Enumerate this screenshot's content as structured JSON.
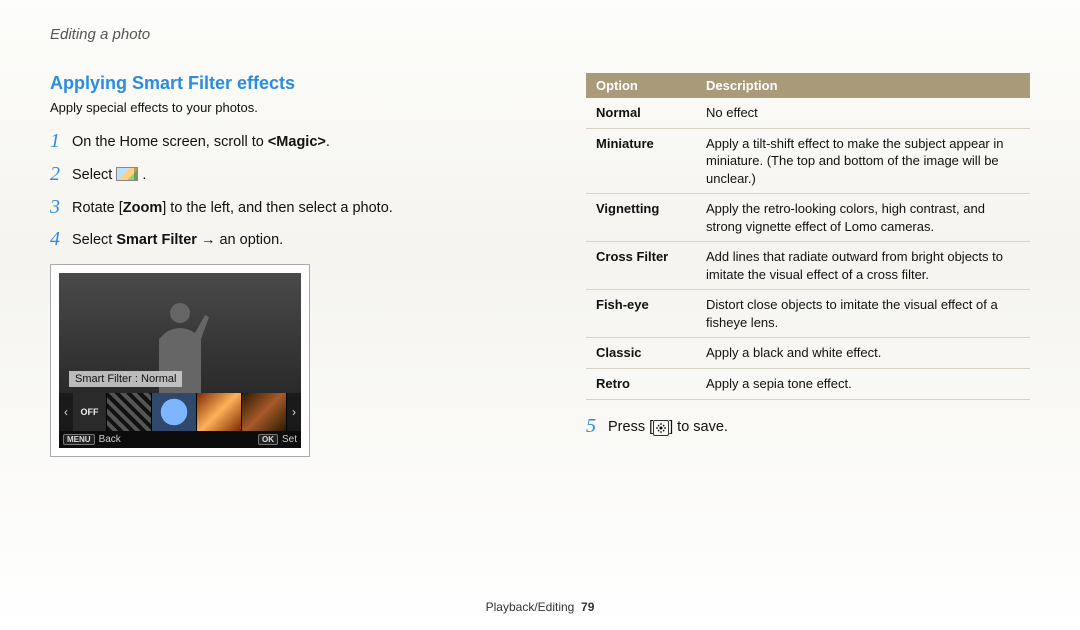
{
  "header": {
    "breadcrumb": "Editing a photo"
  },
  "section": {
    "title": "Applying Smart Filter effects",
    "intro": "Apply special effects to your photos."
  },
  "steps_left": [
    {
      "prefix": "On the Home screen, scroll to ",
      "bold": "<Magic>",
      "suffix": "."
    },
    {
      "prefix": "Select ",
      "icon": "photo-edit-icon",
      "suffix": " ."
    },
    {
      "prefix": "Rotate ",
      "bold_bracket": "[Zoom]",
      "suffix": " to the left, and then select a photo."
    },
    {
      "prefix": "Select ",
      "bold": "Smart Filter",
      "suffix": " → an option."
    }
  ],
  "preview": {
    "label": "Smart Filter : Normal",
    "off_label": "OFF",
    "menu_label": "MENU",
    "menu_text": "Back",
    "ok_label": "OK",
    "ok_text": "Set"
  },
  "options_table": {
    "headers": [
      "Option",
      "Description"
    ],
    "rows": [
      {
        "option": "Normal",
        "desc": "No effect"
      },
      {
        "option": "Miniature",
        "desc": "Apply a tilt-shift effect to make the subject appear in miniature. (The top and bottom of the image will be unclear.)"
      },
      {
        "option": "Vignetting",
        "desc": "Apply the retro-looking colors, high contrast, and strong vignette effect of Lomo cameras."
      },
      {
        "option": "Cross Filter",
        "desc": "Add lines that radiate outward from bright objects to imitate the visual effect of a cross filter."
      },
      {
        "option": "Fish-eye",
        "desc": "Distort close objects to imitate the visual effect of a fisheye lens."
      },
      {
        "option": "Classic",
        "desc": "Apply a black and white effect."
      },
      {
        "option": "Retro",
        "desc": "Apply a sepia tone effect."
      }
    ]
  },
  "steps_right": [
    {
      "num": "5",
      "prefix": "Press [",
      "icon": "save-flower-icon",
      "suffix": "] to save."
    }
  ],
  "footer": {
    "section": "Playback/Editing",
    "page": "79"
  }
}
